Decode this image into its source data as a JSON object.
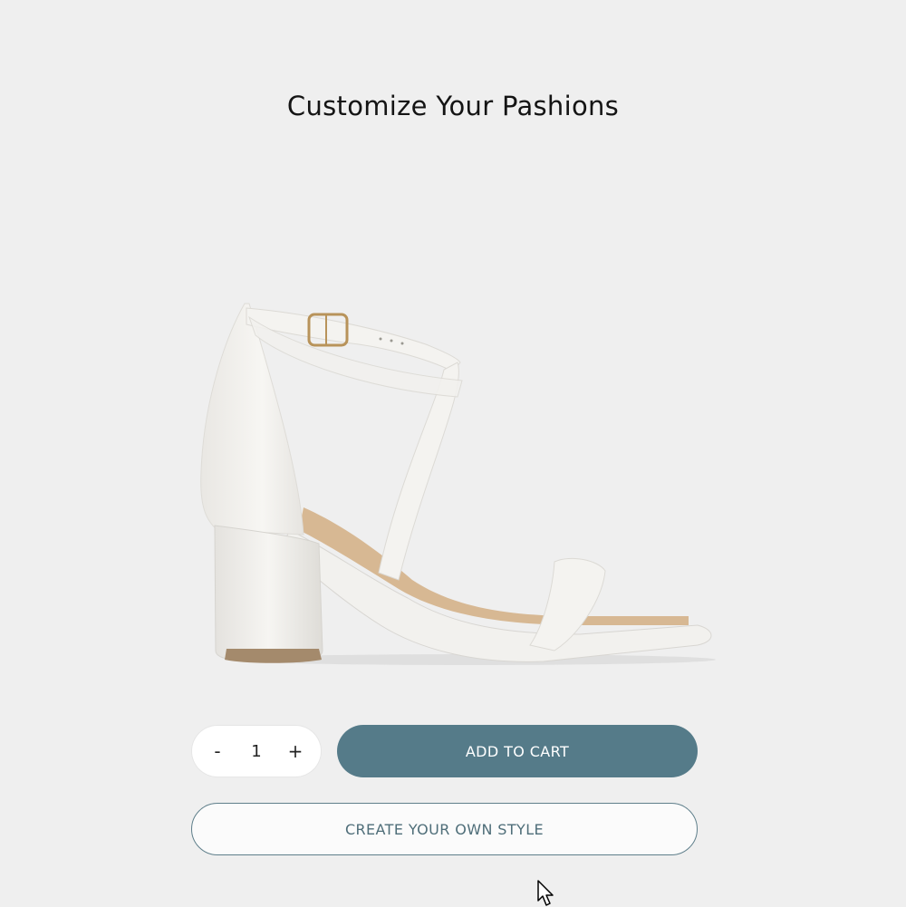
{
  "page": {
    "title": "Customize Your Pashions"
  },
  "product": {
    "image_icon": "strappy-block-heel-sandal",
    "colors": {
      "leather": "#f3f1ed",
      "insole": "#d7b893",
      "buckle": "#b8935a",
      "background": "#efefef"
    }
  },
  "quantity": {
    "decrement_label": "-",
    "value": "1",
    "increment_label": "+"
  },
  "actions": {
    "add_to_cart_label": "ADD TO CART",
    "create_style_label": "CREATE YOUR OWN STYLE"
  },
  "colors": {
    "accent": "#557b89",
    "outline": "#5f7f8b"
  }
}
